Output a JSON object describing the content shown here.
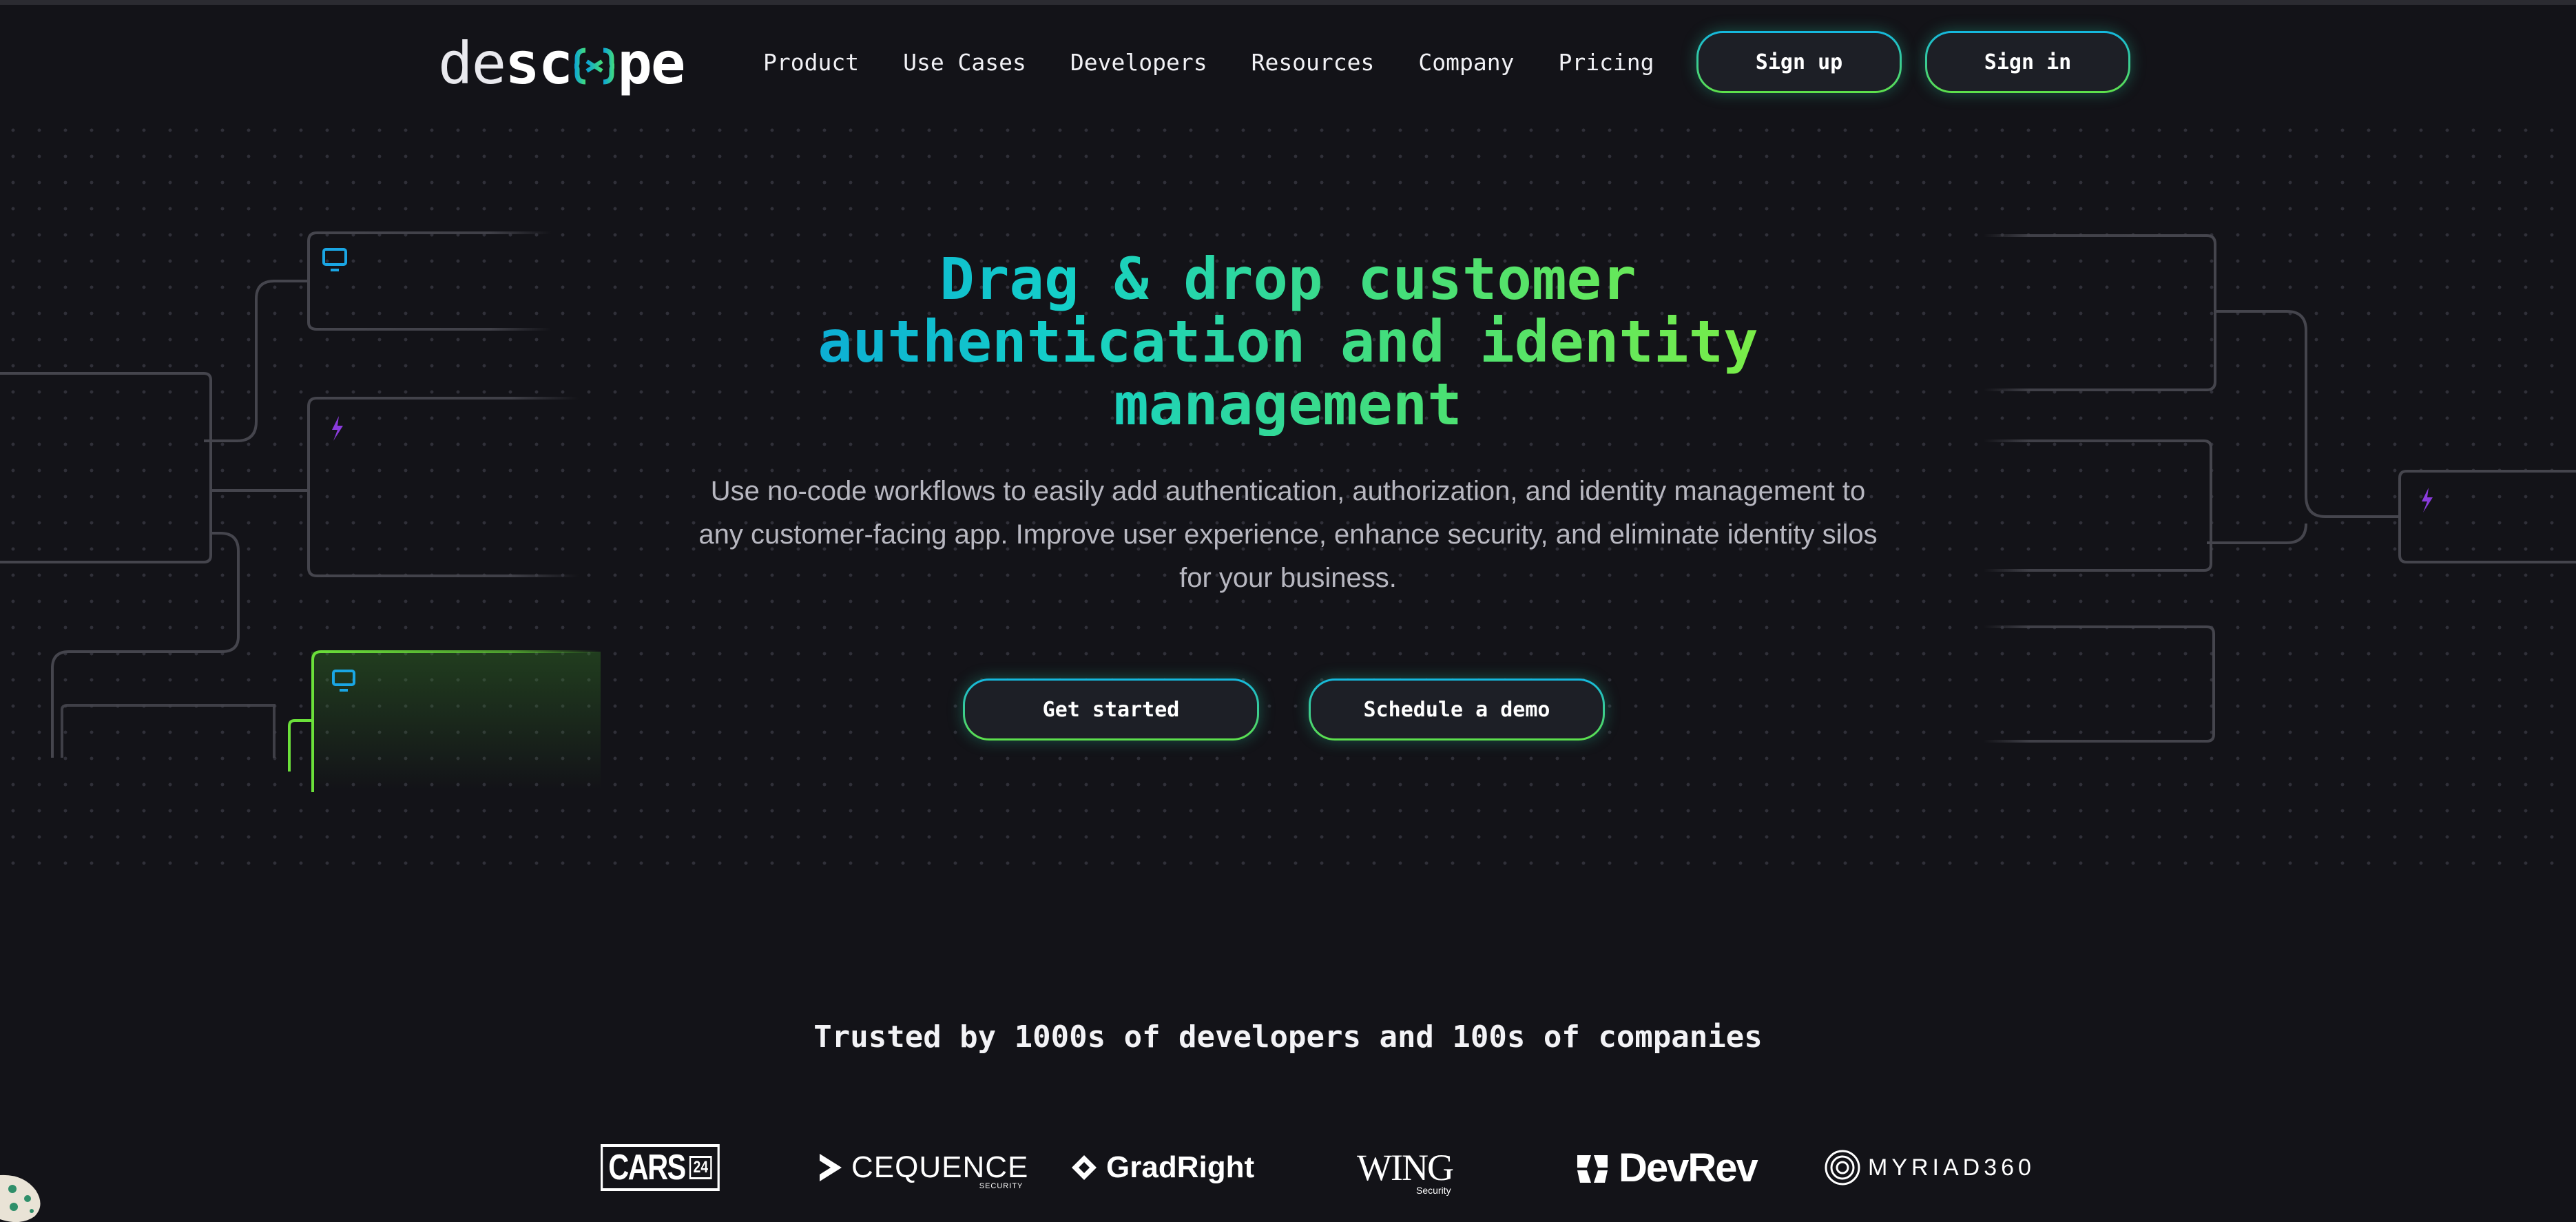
{
  "brand": {
    "logo_light": "de",
    "logo_bold_a": "sc",
    "logo_bold_b": "pe",
    "accent_colors": [
      "#0aa3d8",
      "#14d0c8",
      "#44de7a",
      "#86f03c"
    ],
    "background": "#131318"
  },
  "nav": {
    "items": [
      {
        "label": "Product"
      },
      {
        "label": "Use Cases"
      },
      {
        "label": "Developers"
      },
      {
        "label": "Resources"
      },
      {
        "label": "Company"
      },
      {
        "label": "Pricing"
      }
    ],
    "signup_label": "Sign up",
    "signin_label": "Sign in"
  },
  "hero": {
    "title_lines": [
      "Drag & drop customer",
      "authentication and identity",
      "management"
    ],
    "subtitle_lines": [
      "Use no-code workflows to easily add authentication, authorization, and identity management to",
      "any customer-facing app. Improve user experience, enhance security, and eliminate identity silos",
      "for your business."
    ],
    "get_started_label": "Get started",
    "demo_label": "Schedule a demo"
  },
  "trust": {
    "heading": "Trusted by 1000s of developers and 100s of companies",
    "logos": {
      "cars": "CARS",
      "cars_num": "24",
      "cequence": "CEQUENCE",
      "cequence_tag": "SECURITY",
      "gradright": "GradRight",
      "wing": "WING",
      "wing_tag": "Security",
      "devrev": "DevRev",
      "myriad": "MYRIAD360"
    }
  },
  "icons": [
    "monitor-icon",
    "lightning-icon",
    "cookie-icon"
  ]
}
